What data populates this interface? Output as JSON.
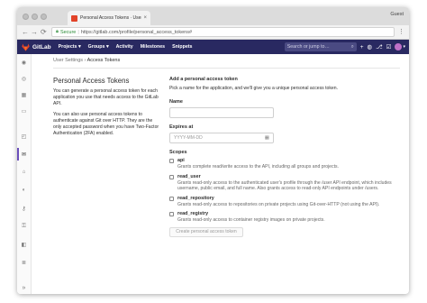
{
  "browser": {
    "tab_title": "Personal Access Tokens · User S",
    "tab_close": "×",
    "guest": "Guest",
    "secure_label": "Secure",
    "separator": "|",
    "url": "https://gitlab.com/profile/personal_access_tokens#",
    "back": "←",
    "forward": "→",
    "reload": "⟳",
    "menu": "⋮",
    "icons": [
      "back-arrow-icon",
      "forward-arrow-icon",
      "reload-icon",
      "lock-icon",
      "menu-icon"
    ]
  },
  "navbar": {
    "brand": "GitLab",
    "items": [
      "Projects ▾",
      "Groups ▾",
      "Activity",
      "Milestones",
      "Snippets"
    ],
    "search_placeholder": "Search or jump to…",
    "search_icon": "⌕",
    "icons": [
      "+",
      "◍",
      "⎇",
      "☑"
    ],
    "avatar_caret": "▾",
    "colors": {
      "bar": "#292961",
      "logo": "#e24329",
      "avatar": "#c070c8"
    }
  },
  "sidebar": {
    "icons": [
      "user-icon",
      "account-icon",
      "applications-icon",
      "chat-icon",
      "access-tokens-icon",
      "emails-icon",
      "password-icon",
      "notifications-icon",
      "ssh-keys-icon",
      "gpg-keys-icon",
      "preferences-icon",
      "authentication-log-icon",
      "collapse-icon"
    ],
    "glyphs": [
      "◉",
      "◎",
      "▦",
      "▭",
      "◰",
      "✉",
      "⌂",
      "◐",
      "⚷",
      "⚿",
      "◧",
      "≣",
      "»"
    ],
    "active_index": 5,
    "active_color": "#6b4fbb"
  },
  "breadcrumb": {
    "parent": "User Settings",
    "separator": "›",
    "current": "Access Tokens"
  },
  "intro": {
    "title": "Personal Access Tokens",
    "p1": "You can generate a personal access token for each application you use that needs access to the GitLab API.",
    "p2": "You can also use personal access tokens to authenticate against Git over HTTP. They are the only accepted password when you have Two-Factor Authentication (2FA) enabled."
  },
  "form": {
    "heading": "Add a personal access token",
    "subheading": "Pick a name for the application, and we'll give you a unique personal access token.",
    "name_label": "Name",
    "expires_label": "Expires at",
    "expires_placeholder": "YYYY-MM-DD",
    "calendar_glyph": "▦",
    "scopes_label": "Scopes",
    "scopes": [
      {
        "name": "api",
        "desc": "Grants complete read/write access to the API, including all groups and projects."
      },
      {
        "name": "read_user",
        "desc": "Grants read-only access to the authenticated user's profile through the /user API endpoint, which includes username, public email, and full name. Also grants access to read-only API endpoints under /users."
      },
      {
        "name": "read_repository",
        "desc": "Grants read-only access to repositories on private projects using Git-over-HTTP (not using the API)."
      },
      {
        "name": "read_registry",
        "desc": "Grants read-only access to container registry images on private projects."
      }
    ],
    "submit_label": "Create personal access token"
  }
}
